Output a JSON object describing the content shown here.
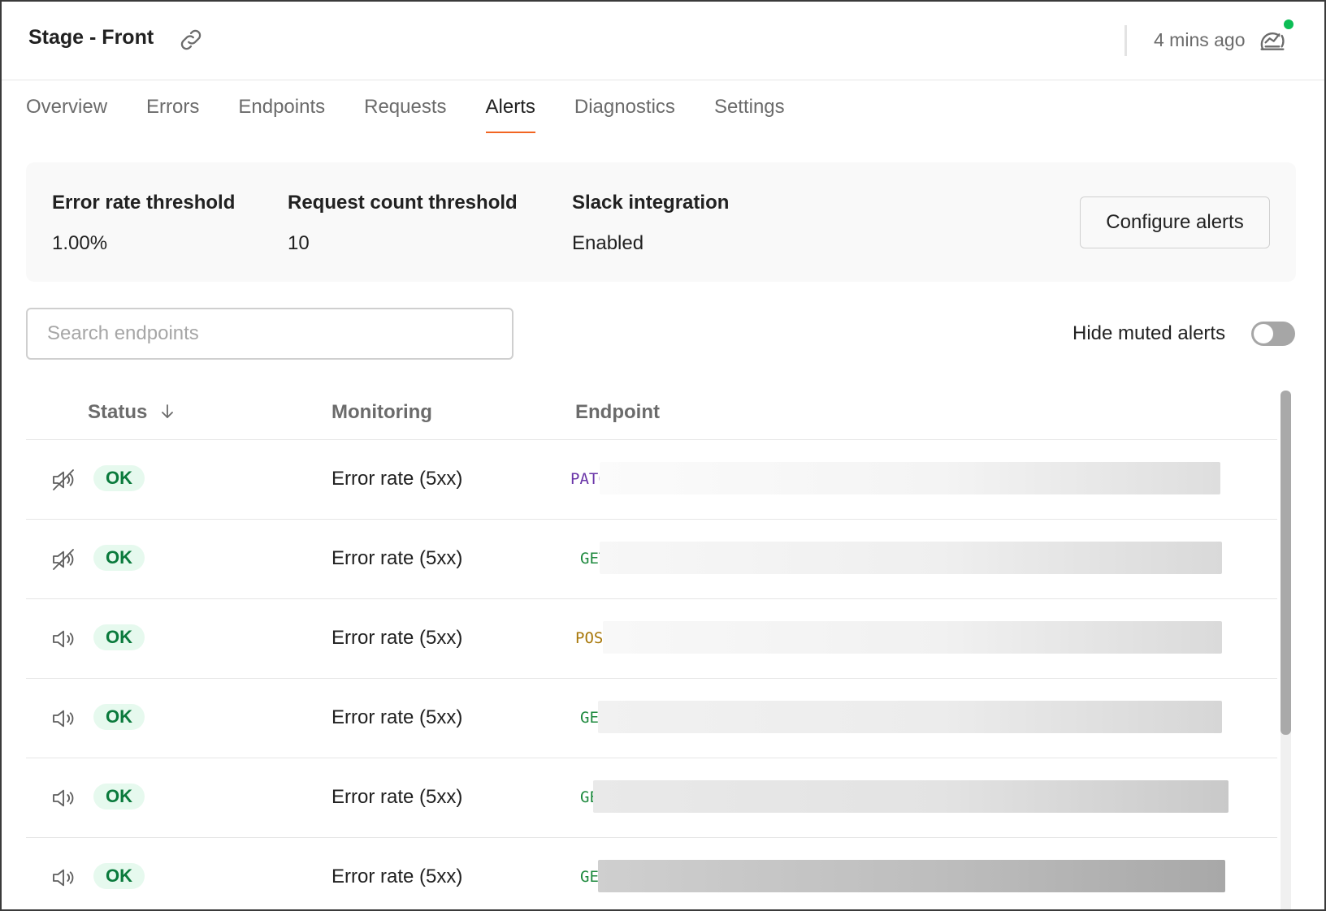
{
  "header": {
    "title": "Stage - Front",
    "last_updated": "4 mins ago"
  },
  "tabs": [
    {
      "label": "Overview",
      "active": false
    },
    {
      "label": "Errors",
      "active": false
    },
    {
      "label": "Endpoints",
      "active": false
    },
    {
      "label": "Requests",
      "active": false
    },
    {
      "label": "Alerts",
      "active": true
    },
    {
      "label": "Diagnostics",
      "active": false
    },
    {
      "label": "Settings",
      "active": false
    }
  ],
  "summary": {
    "error_rate": {
      "label": "Error rate threshold",
      "value": "1.00%"
    },
    "request_count": {
      "label": "Request count threshold",
      "value": "10"
    },
    "slack": {
      "label": "Slack integration",
      "value": "Enabled"
    },
    "configure_label": "Configure alerts"
  },
  "search": {
    "placeholder": "Search endpoints",
    "value": ""
  },
  "toggle": {
    "label": "Hide muted alerts",
    "on": false
  },
  "table": {
    "columns": {
      "status": "Status",
      "monitoring": "Monitoring",
      "endpoint": "Endpoint"
    },
    "rows": [
      {
        "muted": true,
        "status": "OK",
        "monitoring": "Error rate (5xx)",
        "method": "PATCH"
      },
      {
        "muted": true,
        "status": "OK",
        "monitoring": "Error rate (5xx)",
        "method": "GET"
      },
      {
        "muted": false,
        "status": "OK",
        "monitoring": "Error rate (5xx)",
        "method": "POST"
      },
      {
        "muted": false,
        "status": "OK",
        "monitoring": "Error rate (5xx)",
        "method": "GET"
      },
      {
        "muted": false,
        "status": "OK",
        "monitoring": "Error rate (5xx)",
        "method": "GET"
      },
      {
        "muted": false,
        "status": "OK",
        "monitoring": "Error rate (5xx)",
        "method": "GET"
      }
    ]
  },
  "colors": {
    "accent": "#f26522",
    "ok_badge_bg": "#e6f9ee",
    "ok_badge_text": "#0a7a3c",
    "online_dot": "#0cbd55",
    "method_patch": "#6a35a8",
    "method_get": "#1f8a3f",
    "method_post": "#a8780a"
  }
}
